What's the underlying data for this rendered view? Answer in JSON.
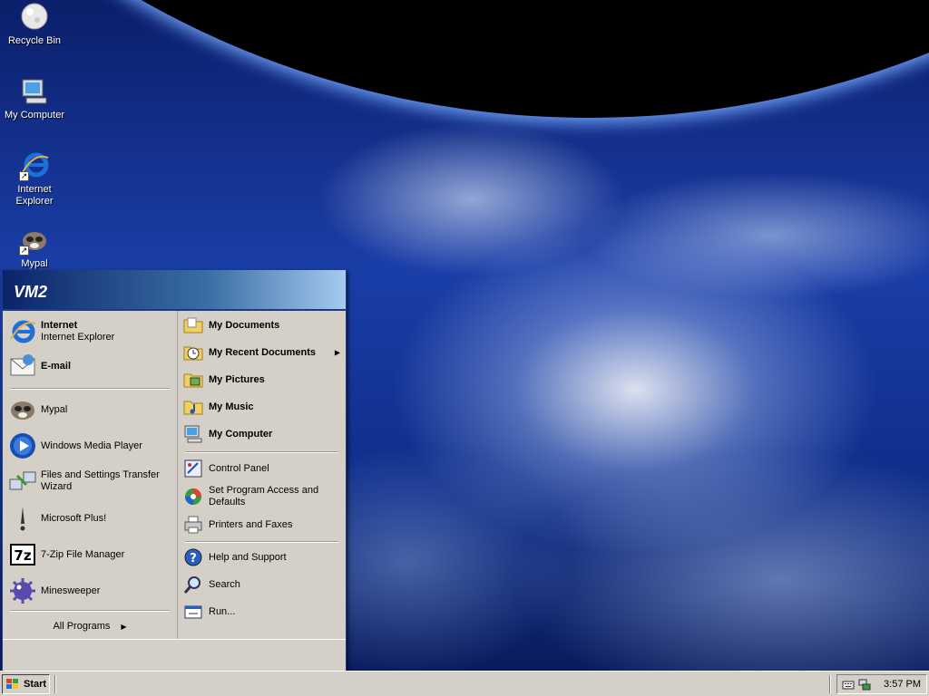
{
  "desktop": {
    "icons": [
      {
        "label": "Recycle Bin",
        "icon": "recycle-bin-icon"
      },
      {
        "label": "My Computer",
        "icon": "my-computer-icon"
      },
      {
        "label": "Internet Explorer",
        "icon": "internet-explorer-icon"
      },
      {
        "label": "Mypal",
        "icon": "mypal-icon"
      }
    ]
  },
  "start_menu": {
    "user": "VM2",
    "pinned": [
      {
        "title": "Internet",
        "subtitle": "Internet Explorer",
        "icon": "internet-explorer-icon"
      },
      {
        "title": "E-mail",
        "icon": "email-icon"
      }
    ],
    "recent": [
      {
        "label": "Mypal",
        "icon": "mypal-icon"
      },
      {
        "label": "Windows Media Player",
        "icon": "media-player-icon"
      },
      {
        "label": "Files and Settings Transfer Wizard",
        "icon": "transfer-wizard-icon"
      },
      {
        "label": "Microsoft Plus!",
        "icon": "microsoft-plus-icon"
      },
      {
        "label": "7-Zip File Manager",
        "icon": "7zip-icon"
      },
      {
        "label": "Minesweeper",
        "icon": "minesweeper-icon"
      }
    ],
    "all_programs": "All Programs",
    "right_places": [
      {
        "label": "My Documents",
        "icon": "my-documents-icon"
      },
      {
        "label": "My Recent Documents",
        "icon": "recent-documents-icon"
      },
      {
        "label": "My Pictures",
        "icon": "my-pictures-icon"
      },
      {
        "label": "My Music",
        "icon": "my-music-icon"
      },
      {
        "label": "My Computer",
        "icon": "my-computer-icon"
      }
    ],
    "right_settings": [
      {
        "label": "Control Panel",
        "icon": "control-panel-icon"
      },
      {
        "label": "Set Program Access and Defaults",
        "icon": "program-access-icon"
      },
      {
        "label": "Printers and Faxes",
        "icon": "printer-icon"
      }
    ],
    "right_help": [
      {
        "label": "Help and Support",
        "icon": "help-icon"
      },
      {
        "label": "Search",
        "icon": "search-icon"
      },
      {
        "label": "Run...",
        "icon": "run-icon"
      }
    ]
  },
  "taskbar": {
    "start_label": "Start",
    "clock": "3:57 PM"
  },
  "colors": {
    "taskbar": "#d4d0c8",
    "menu_header_start": "#0a246a",
    "menu_header_end": "#a6caf0"
  }
}
